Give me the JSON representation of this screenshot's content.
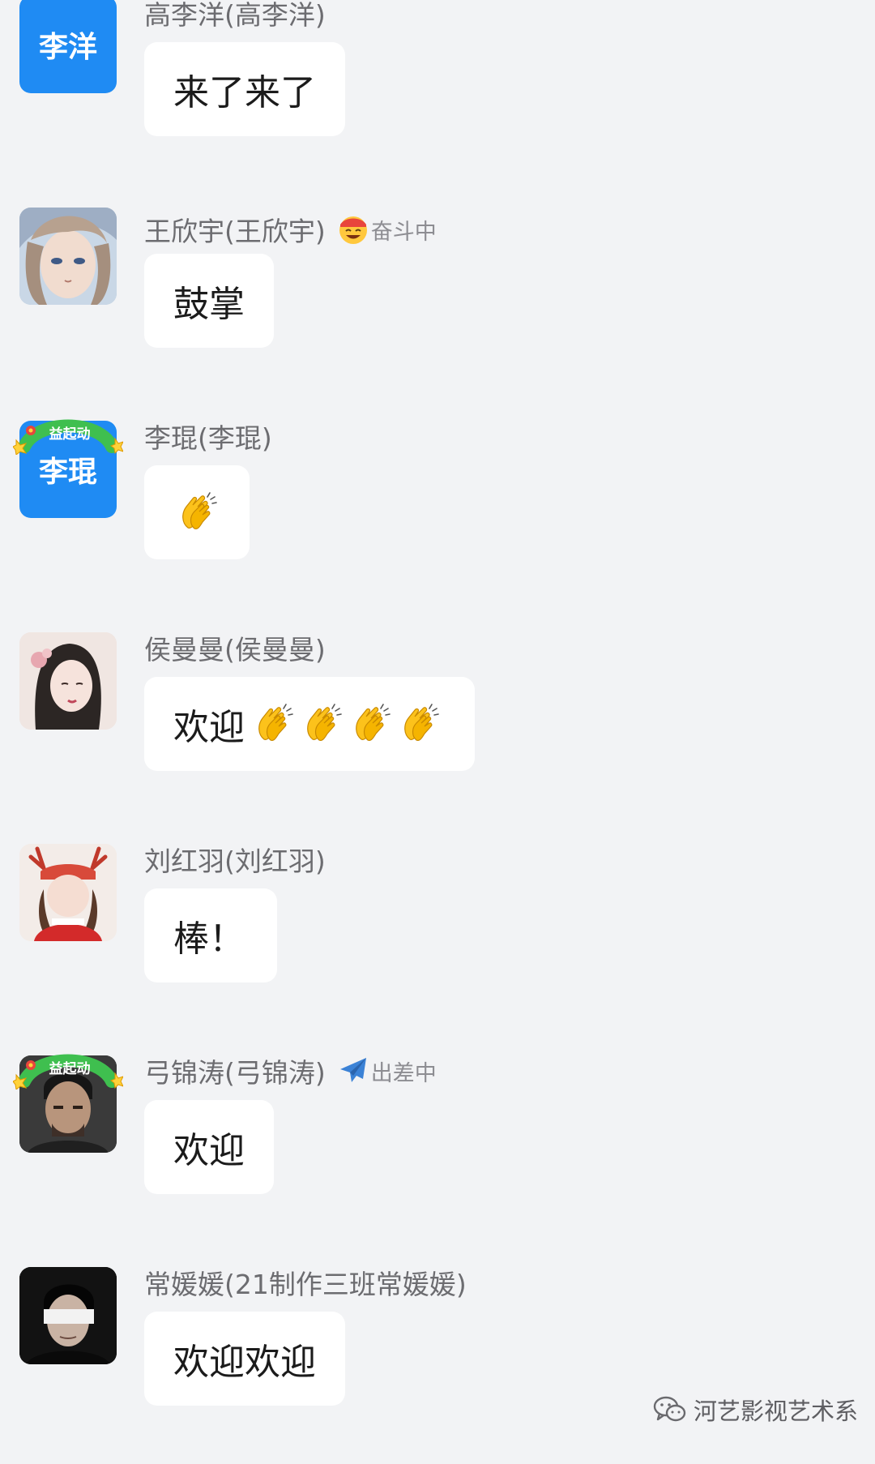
{
  "messages": [
    {
      "sender": "高李洋(高李洋)",
      "avatar_text": "李洋",
      "text": "来了来了",
      "claps": 0
    },
    {
      "sender": "王欣宇(王欣宇)",
      "status_label": "奋斗中",
      "status_icon": "grinning-emoji-icon",
      "text": "鼓掌",
      "claps": 0
    },
    {
      "sender": "李琨(李琨)",
      "avatar_text": "李琨",
      "avatar_frame_text": "益起动",
      "text": "",
      "claps": 1
    },
    {
      "sender": "侯曼曼(侯曼曼)",
      "text": "欢迎",
      "claps": 4
    },
    {
      "sender": "刘红羽(刘红羽)",
      "text": "棒！",
      "claps": 0
    },
    {
      "sender": "弓锦涛(弓锦涛)",
      "avatar_frame_text": "益起动",
      "status_label": "出差中",
      "status_icon": "airplane-icon",
      "text": "欢迎",
      "claps": 0
    },
    {
      "sender": "常媛媛(21制作三班常媛媛)",
      "text": "欢迎欢迎",
      "claps": 0
    }
  ],
  "watermark": {
    "text": "河艺影视艺术系",
    "icon": "wechat-icon"
  },
  "colors": {
    "background": "#f2f3f5",
    "bubble": "#ffffff",
    "avatar_blue": "#1f8bf3",
    "name_text": "#6c6c70"
  }
}
